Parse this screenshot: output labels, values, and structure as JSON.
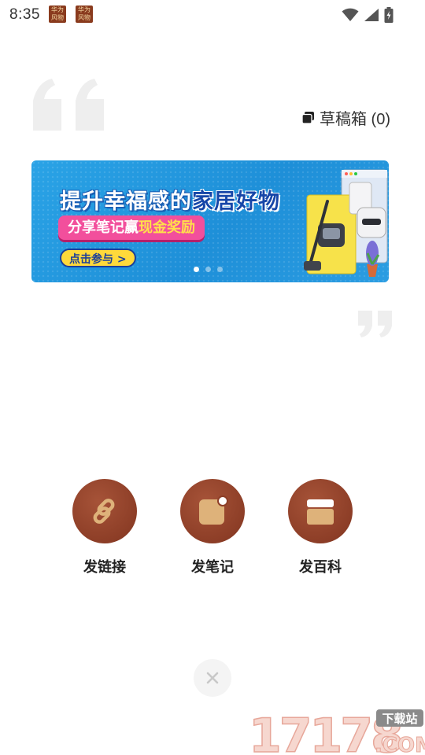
{
  "status_bar": {
    "time": "8:35",
    "app_icons": [
      "华为风物",
      "华为风物"
    ],
    "app_icon_lines": [
      [
        "华为",
        "风物"
      ],
      [
        "华为",
        "风物"
      ]
    ],
    "icons": [
      "wifi-icon",
      "signal-icon",
      "battery-charging-icon"
    ]
  },
  "drafts": {
    "icon": "drafts-box-icon",
    "label": "草稿箱 (0)"
  },
  "banner": {
    "title_part1": "提升幸福感的",
    "title_part2": "家居好物",
    "subtitle_part1": "分享笔记赢",
    "subtitle_part2": "现金奖励",
    "button_label": "点击参与 >",
    "page_count": 3,
    "active_page": 1
  },
  "actions": [
    {
      "label": "发链接",
      "icon": "link-icon"
    },
    {
      "label": "发笔记",
      "icon": "note-icon"
    },
    {
      "label": "发百科",
      "icon": "encyclopedia-icon"
    }
  ],
  "close": {
    "icon": "close-icon"
  },
  "watermark": {
    "number": "17178",
    "tag": "下载站",
    "domain": ".COM"
  },
  "colors": {
    "accent_brown": "#8d3e27",
    "icon_tan": "#deb27a",
    "banner_blue": "#1e8fd8",
    "quote_gray": "#eeeeee"
  }
}
